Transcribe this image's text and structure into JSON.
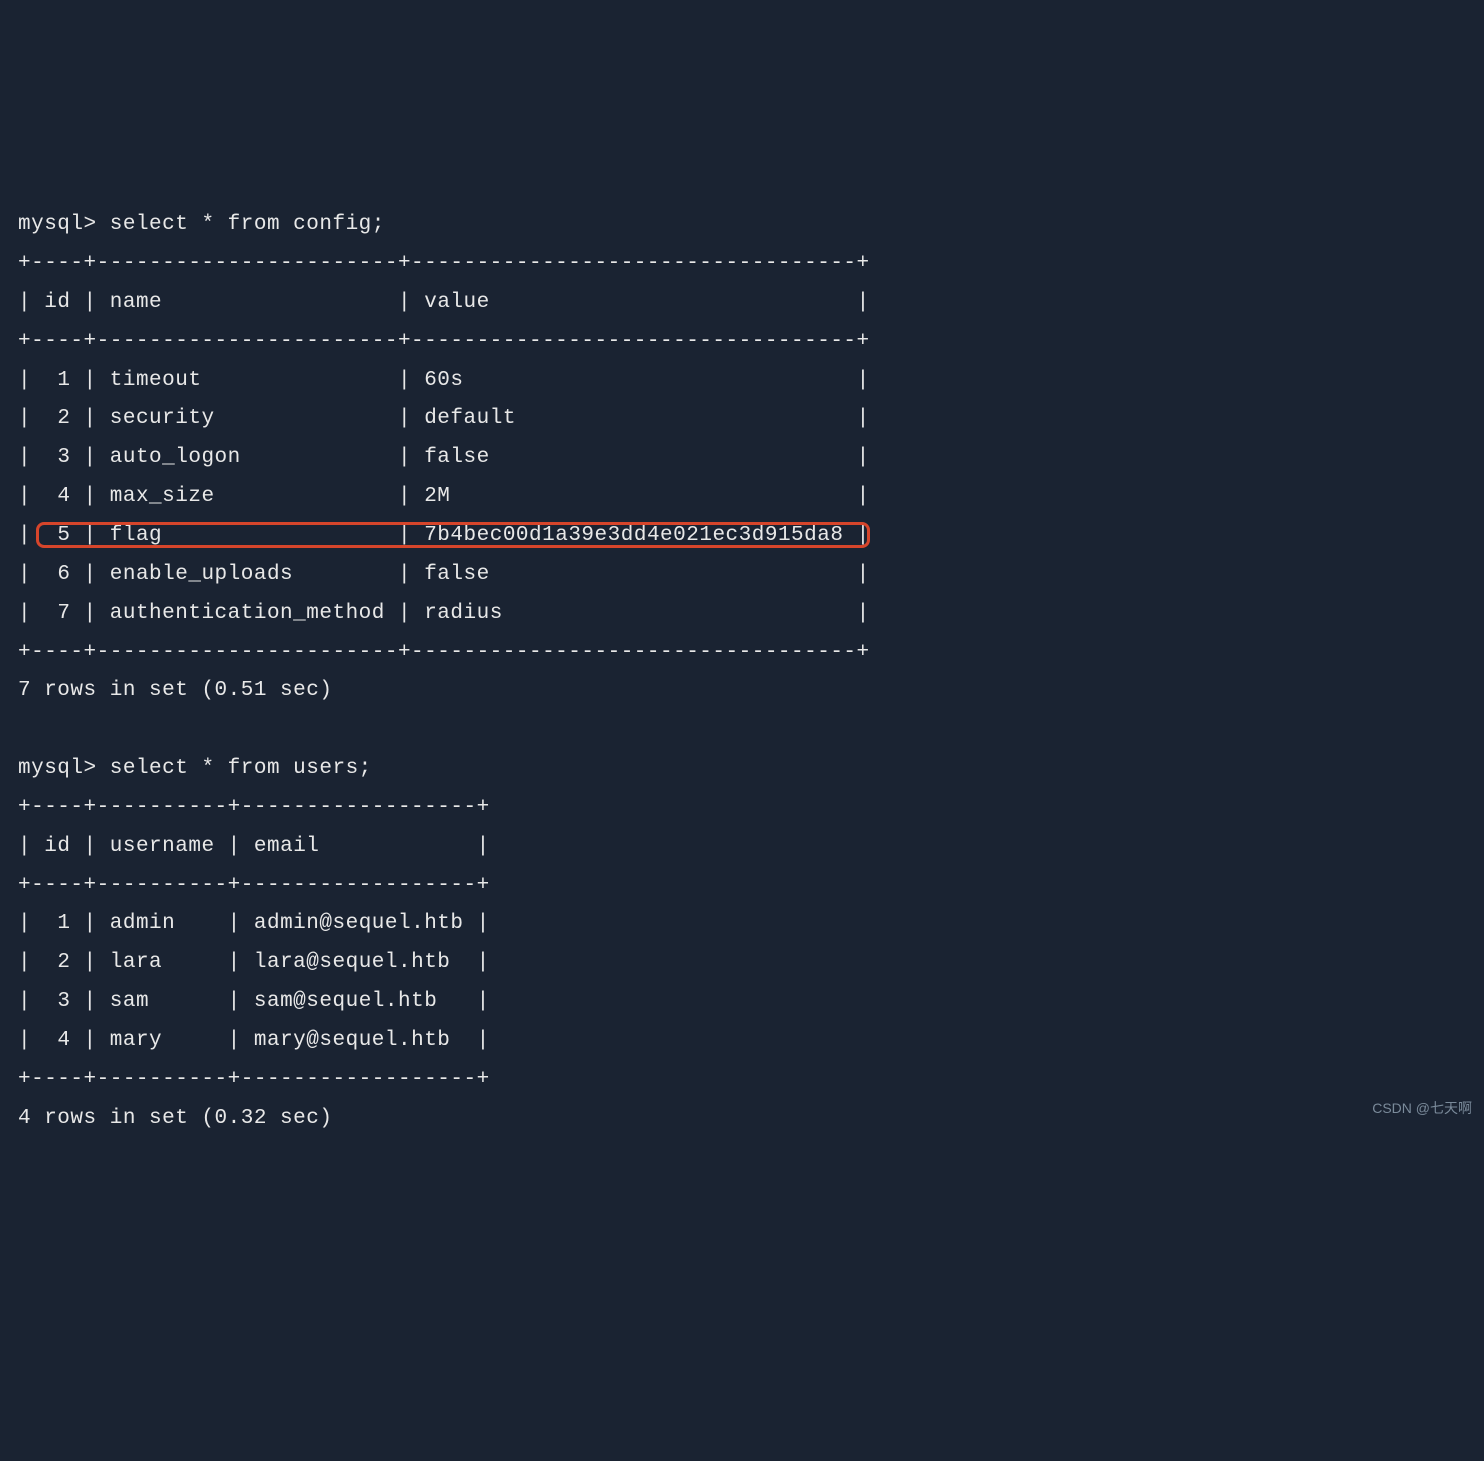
{
  "prompt": "mysql>",
  "query1": {
    "command": "select * from config;",
    "headers": [
      "id",
      "name",
      "value"
    ],
    "rows": [
      {
        "id": "1",
        "name": "timeout",
        "value": "60s"
      },
      {
        "id": "2",
        "name": "security",
        "value": "default"
      },
      {
        "id": "3",
        "name": "auto_logon",
        "value": "false"
      },
      {
        "id": "4",
        "name": "max_size",
        "value": "2M"
      },
      {
        "id": "5",
        "name": "flag",
        "value": "7b4bec00d1a39e3dd4e021ec3d915da8"
      },
      {
        "id": "6",
        "name": "enable_uploads",
        "value": "false"
      },
      {
        "id": "7",
        "name": "authentication_method",
        "value": "radius"
      }
    ],
    "footer": "7 rows in set (0.51 sec)",
    "highlighted_row_index": 4
  },
  "query2": {
    "command": "select * from users;",
    "headers": [
      "id",
      "username",
      "email"
    ],
    "rows": [
      {
        "id": "1",
        "username": "admin",
        "email": "admin@sequel.htb"
      },
      {
        "id": "2",
        "username": "lara",
        "email": "lara@sequel.htb"
      },
      {
        "id": "3",
        "username": "sam",
        "email": "sam@sequel.htb"
      },
      {
        "id": "4",
        "username": "mary",
        "email": "mary@sequel.htb"
      }
    ],
    "footer": "4 rows in set (0.32 sec)"
  },
  "watermark": "CSDN @七天啊"
}
